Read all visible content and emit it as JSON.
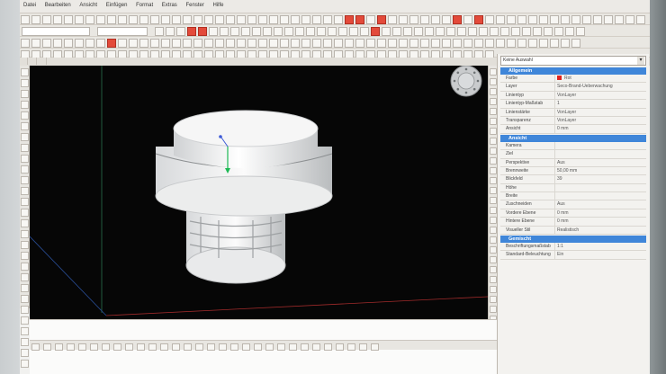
{
  "menu": {
    "items": [
      "Datei",
      "Bearbeiten",
      "Ansicht",
      "Einfügen",
      "Format",
      "Extras",
      "Fenster",
      "Hilfe"
    ]
  },
  "toolbar": {
    "field_a": "",
    "field_b": ""
  },
  "properties": {
    "selection": "Keine Auswahl",
    "sections": {
      "general": {
        "title": "Allgemein",
        "rows": [
          {
            "k": "Farbe",
            "v": "Rot"
          },
          {
            "k": "Layer",
            "v": "Seco-Brand-Ueberwachung"
          },
          {
            "k": "Linientyp",
            "v": "VonLayer"
          },
          {
            "k": "Linientyp-Maßstab",
            "v": "1"
          },
          {
            "k": "Linienstärke",
            "v": "VonLayer"
          },
          {
            "k": "Transparenz",
            "v": "VonLayer"
          },
          {
            "k": "Ansicht",
            "v": "0 mm"
          }
        ]
      },
      "view": {
        "title": "Ansicht",
        "rows": [
          {
            "k": "Kamera",
            "v": ""
          },
          {
            "k": "Ziel",
            "v": ""
          },
          {
            "k": "Perspektive",
            "v": "Aus"
          },
          {
            "k": "Brennweite",
            "v": "50,00 mm"
          },
          {
            "k": "Blickfeld",
            "v": "39"
          },
          {
            "k": "Höhe",
            "v": ""
          },
          {
            "k": "Breite",
            "v": ""
          },
          {
            "k": "Zuschneiden",
            "v": "Aus"
          },
          {
            "k": "Vordere Ebene",
            "v": "0 mm"
          },
          {
            "k": "Hintere Ebene",
            "v": "0 mm"
          },
          {
            "k": "Visueller Stil",
            "v": "Realistisch"
          }
        ]
      },
      "misc": {
        "title": "Gemischt",
        "rows": [
          {
            "k": "Beschriftungsmaßstab",
            "v": "1:1"
          },
          {
            "k": "Standard-Beleuchtung",
            "v": "Ein"
          }
        ]
      }
    }
  },
  "colors": {
    "accent": "#3f86d9",
    "viewport_bg": "#060606",
    "swatch": "#e0231e"
  },
  "icons": [
    "navigation-wheel-icon",
    "ucs-icon",
    "close-icon"
  ]
}
